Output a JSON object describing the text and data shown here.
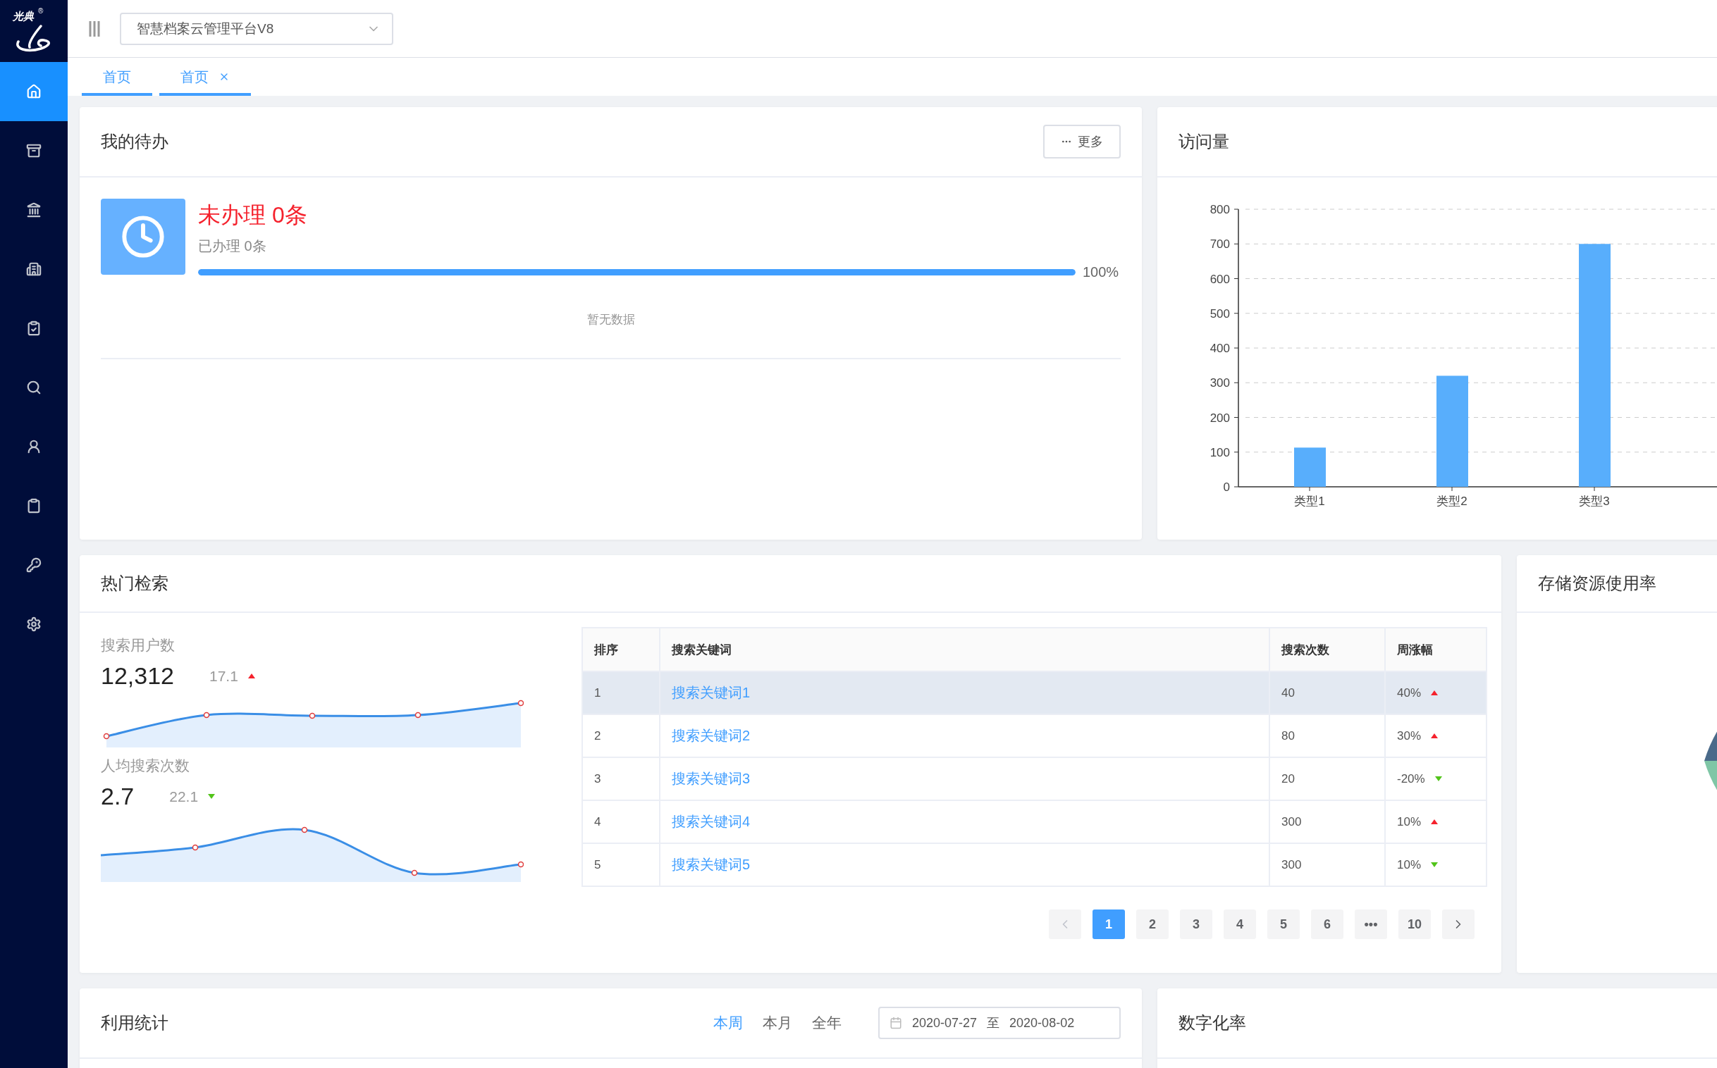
{
  "logo": {
    "text": "光典",
    "mark": "®"
  },
  "sidebar": {
    "items": [
      {
        "kind": "home",
        "selected": true
      },
      {
        "kind": "archive",
        "selected": false
      },
      {
        "kind": "bank",
        "selected": false
      },
      {
        "kind": "building",
        "selected": false
      },
      {
        "kind": "checklist",
        "selected": false
      },
      {
        "kind": "search",
        "selected": false
      },
      {
        "kind": "user",
        "selected": false
      },
      {
        "kind": "clipboard",
        "selected": false
      },
      {
        "kind": "key",
        "selected": false
      },
      {
        "kind": "settings",
        "selected": false
      }
    ]
  },
  "header": {
    "platform_select": {
      "value": "智慧档案云管理平台V8"
    }
  },
  "tabs": [
    {
      "label": "首页",
      "selected": true,
      "closable": false
    },
    {
      "label": "首页",
      "selected": true,
      "closable": true
    }
  ],
  "todo": {
    "title": "我的待办",
    "more_button": "更多",
    "pending": "未办理 0条",
    "done": "已办理 0条",
    "level": 1,
    "percent": "100%",
    "empty": "暂无数据"
  },
  "visits": {
    "title": "访问量",
    "chart_data": {
      "type": "bar",
      "categories": [
        "类型1",
        "类型2",
        "类型3"
      ],
      "values": [
        113,
        320,
        700
      ],
      "ylim": [
        0,
        800
      ],
      "grid": true,
      "yticks": [
        0,
        100,
        200,
        300,
        400,
        500,
        600,
        700,
        800
      ]
    }
  },
  "hot_search": {
    "title": "热门检索",
    "stats": [
      {
        "label": "搜索用户数",
        "value": "12,312",
        "change": "17.1",
        "rising": true
      },
      {
        "label": "人均搜索次数",
        "value": "2.7",
        "change": "22.1",
        "rising": false
      }
    ],
    "table": {
      "columns": [
        "排序",
        "搜索关键词",
        "搜索次数",
        "周涨幅"
      ],
      "rows": [
        {
          "rank": "1",
          "keyword": "搜索关键词1",
          "count": "40",
          "change": "40%",
          "rising": true,
          "selected": true
        },
        {
          "rank": "2",
          "keyword": "搜索关键词2",
          "count": "80",
          "change": "30%",
          "rising": true,
          "selected": false
        },
        {
          "rank": "3",
          "keyword": "搜索关键词3",
          "count": "20",
          "change": "-20%",
          "rising": false,
          "selected": false
        },
        {
          "rank": "4",
          "keyword": "搜索关键词4",
          "count": "300",
          "change": "10%",
          "rising": true,
          "selected": false
        },
        {
          "rank": "5",
          "keyword": "搜索关键词5",
          "count": "300",
          "change": "10%",
          "rising": false,
          "selected": false
        }
      ]
    },
    "pagination": {
      "prev_disabled": true,
      "pages": [
        {
          "label": "1",
          "selected": true
        },
        {
          "label": "2",
          "selected": false
        },
        {
          "label": "3",
          "selected": false
        },
        {
          "label": "4",
          "selected": false
        },
        {
          "label": "5",
          "selected": false
        },
        {
          "label": "6",
          "selected": false
        },
        {
          "label": "•••",
          "selected": false
        },
        {
          "label": "10",
          "selected": false
        }
      ]
    }
  },
  "storage": {
    "title": "存储资源使用率"
  },
  "usage": {
    "title": "利用统计",
    "periods": [
      {
        "label": "本周",
        "selected": true
      },
      {
        "label": "本月",
        "selected": false
      },
      {
        "label": "全年",
        "selected": false
      }
    ],
    "date_range": {
      "start": "2020-07-27",
      "separator": "至",
      "end": "2020-08-02"
    }
  },
  "digitization": {
    "title": "数字化率"
  }
}
